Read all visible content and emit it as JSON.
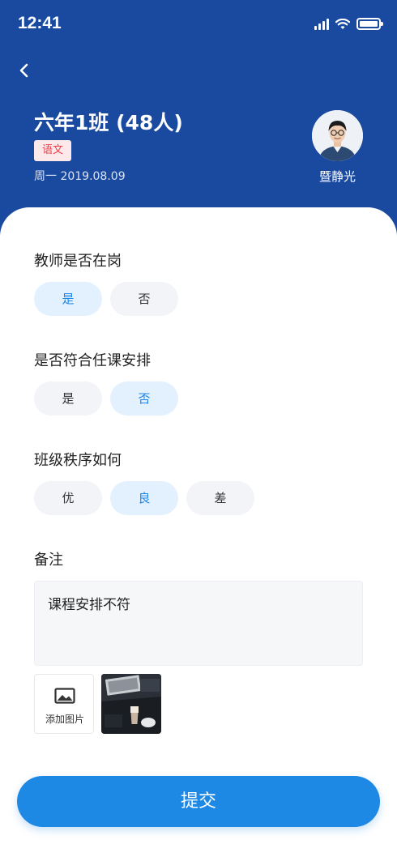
{
  "status_bar": {
    "time": "12:41"
  },
  "header": {
    "class_title": "六年1班 (48人)",
    "subject_tag": "语文",
    "date": "周一 2019.08.09",
    "teacher_name": "暨静光"
  },
  "questions": [
    {
      "label": "教师是否在岗",
      "options": [
        "是",
        "否"
      ],
      "selected": "是"
    },
    {
      "label": "是否符合任课安排",
      "options": [
        "是",
        "否"
      ],
      "selected": "否"
    },
    {
      "label": "班级秩序如何",
      "options": [
        "优",
        "良",
        "差"
      ],
      "selected": "良"
    }
  ],
  "remark": {
    "label": "备注",
    "value": "课程安排不符"
  },
  "photos": {
    "add_label": "添加图片"
  },
  "submit_label": "提交",
  "colors": {
    "header": "#1a4aa0",
    "accent": "#1e88e5",
    "tag_red": "#e8404a"
  }
}
